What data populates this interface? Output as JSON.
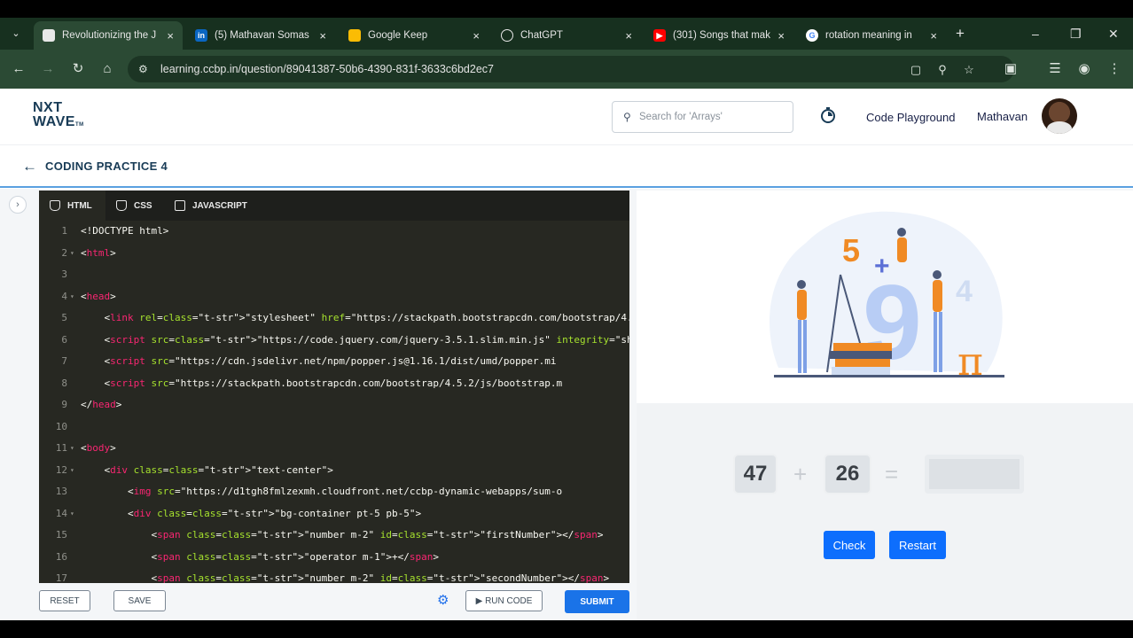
{
  "browser": {
    "tabs": [
      {
        "title": "Revolutionizing the J",
        "favicon": "page-icon",
        "favicon_color": "#e8e8e8",
        "active": true
      },
      {
        "title": "(5) Mathavan Somas",
        "favicon": "linkedin-icon",
        "favicon_color": "#0a66c2",
        "active": false
      },
      {
        "title": "Google Keep",
        "favicon": "keep-icon",
        "favicon_color": "#fbbc04",
        "active": false
      },
      {
        "title": "ChatGPT",
        "favicon": "chatgpt-icon",
        "favicon_color": "#e8e8e8",
        "active": false
      },
      {
        "title": "(301) Songs that mak",
        "favicon": "youtube-icon",
        "favicon_color": "#ff0000",
        "active": false
      },
      {
        "title": "rotation meaning in",
        "favicon": "google-icon",
        "favicon_color": "#4285f4",
        "active": false
      }
    ],
    "new_tab_label": "+",
    "url": "learning.ccbp.in/question/89041387-50b6-4390-831f-3633c6bd2ec7"
  },
  "header": {
    "logo_line1": "NXT",
    "logo_line2": "WAVE",
    "logo_suffix": "TM",
    "search_placeholder": "Search for 'Arrays'",
    "code_playground": "Code Playground",
    "user_name": "Mathavan"
  },
  "title_bar": {
    "title": "CODING PRACTICE 4"
  },
  "editor": {
    "tabs": [
      {
        "label": "HTML",
        "active": true
      },
      {
        "label": "CSS",
        "active": false
      },
      {
        "label": "JAVASCRIPT",
        "active": false
      }
    ],
    "lines": [
      {
        "n": "1",
        "fold": false,
        "text": "<!DOCTYPE html>"
      },
      {
        "n": "2",
        "fold": true,
        "text": "<html>"
      },
      {
        "n": "3",
        "fold": false,
        "text": ""
      },
      {
        "n": "4",
        "fold": true,
        "text": "<head>"
      },
      {
        "n": "5",
        "fold": false,
        "text": "    <link rel=\"stylesheet\" href=\"https://stackpath.bootstrapcdn.com/bootstrap/4.5"
      },
      {
        "n": "6",
        "fold": false,
        "text": "    <script src=\"https://code.jquery.com/jquery-3.5.1.slim.min.js\" integrity=\"sha"
      },
      {
        "n": "7",
        "fold": false,
        "text": "    <script src=\"https://cdn.jsdelivr.net/npm/popper.js@1.16.1/dist/umd/popper.mi"
      },
      {
        "n": "8",
        "fold": false,
        "text": "    <script src=\"https://stackpath.bootstrapcdn.com/bootstrap/4.5.2/js/bootstrap.m"
      },
      {
        "n": "9",
        "fold": false,
        "text": "</head>"
      },
      {
        "n": "10",
        "fold": false,
        "text": ""
      },
      {
        "n": "11",
        "fold": true,
        "text": "<body>"
      },
      {
        "n": "12",
        "fold": true,
        "text": "    <div class=\"text-center\">"
      },
      {
        "n": "13",
        "fold": false,
        "text": "        <img src=\"https://d1tgh8fmlzexmh.cloudfront.net/ccbp-dynamic-webapps/sum-o"
      },
      {
        "n": "14",
        "fold": true,
        "text": "        <div class=\"bg-container pt-5 pb-5\">"
      },
      {
        "n": "15",
        "fold": false,
        "text": "            <span class=\"number m-2\" id=\"firstNumber\"></span>"
      },
      {
        "n": "16",
        "fold": false,
        "text": "            <span class=\"operator m-1\">+</span>"
      },
      {
        "n": "17",
        "fold": false,
        "text": "            <span class=\"number m-2\" id=\"secondNumber\"></span>"
      }
    ],
    "footer": {
      "reset": "RESET",
      "save": "SAVE",
      "run": "RUN CODE",
      "submit": "SUBMIT"
    }
  },
  "preview": {
    "first_number": "47",
    "operator": "+",
    "second_number": "26",
    "equals": "=",
    "answer_value": "",
    "check_label": "Check",
    "restart_label": "Restart"
  },
  "colors": {
    "tabstrip": "#17301f",
    "toolbar": "#2b4a34",
    "brand_navy": "#183b56",
    "primary_blue": "#0d6efd",
    "editor_bg": "#272822"
  }
}
